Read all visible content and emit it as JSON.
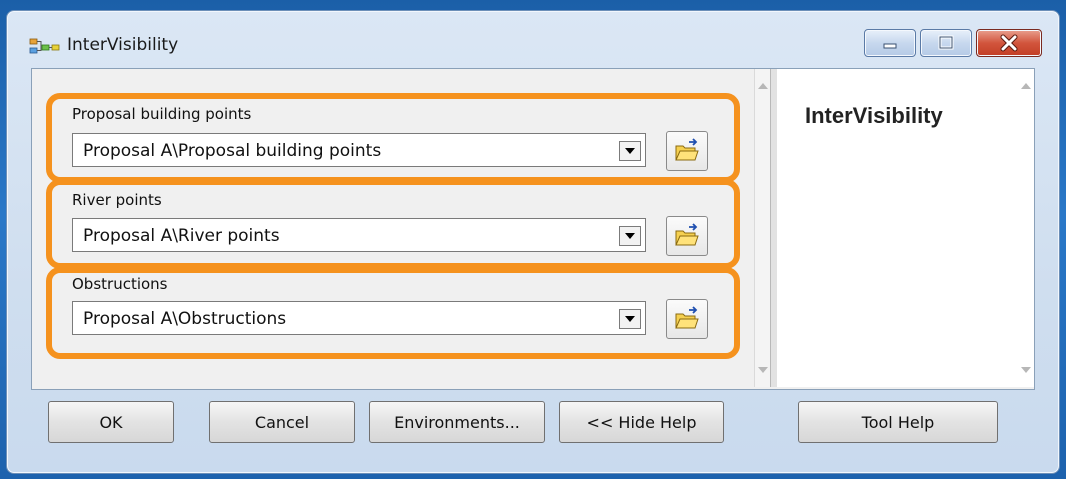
{
  "window": {
    "title": "InterVisibility"
  },
  "params": [
    {
      "label": "Proposal building points",
      "value": "Proposal A\\Proposal building points"
    },
    {
      "label": "River points",
      "value": "Proposal A\\River points"
    },
    {
      "label": "Obstructions",
      "value": "Proposal A\\Obstructions"
    }
  ],
  "help": {
    "title": "InterVisibility"
  },
  "buttons": {
    "ok": "OK",
    "cancel": "Cancel",
    "environments": "Environments...",
    "hide_help": "<< Hide Help",
    "tool_help": "Tool Help"
  },
  "colors": {
    "highlight": "#f5921e",
    "desktop": "#1f66b2"
  }
}
